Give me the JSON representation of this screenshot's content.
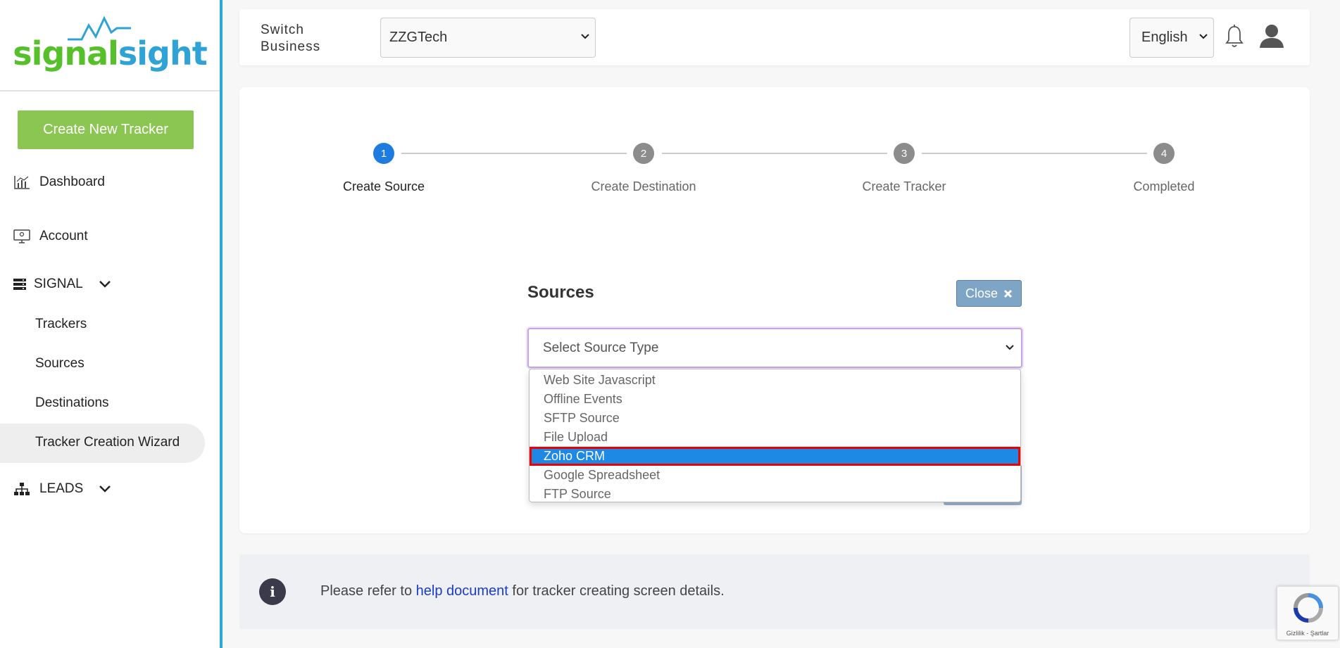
{
  "logo": {
    "part1": "signal",
    "part2": "sight"
  },
  "sidebar": {
    "create_button": "Create New Tracker",
    "items": [
      {
        "label": "Dashboard",
        "icon": "chart-icon"
      },
      {
        "label": "Account",
        "icon": "monitor-icon"
      },
      {
        "label": "SIGNAL",
        "icon": "server-icon"
      },
      {
        "label": "LEADS",
        "icon": "sitemap-icon"
      }
    ],
    "sub_items": [
      "Trackers",
      "Sources",
      "Destinations",
      "Tracker Creation Wizard"
    ]
  },
  "topbar": {
    "switch_label_line1": "Switch",
    "switch_label_line2": "Business",
    "business_value": "ZZGTech",
    "language_value": "English"
  },
  "stepper": {
    "steps": [
      {
        "num": "1",
        "label": "Create Source"
      },
      {
        "num": "2",
        "label": "Create Destination"
      },
      {
        "num": "3",
        "label": "Create Tracker"
      },
      {
        "num": "4",
        "label": "Completed"
      }
    ],
    "active_color": "#1e7be0",
    "inactive_color": "#8c8c8c"
  },
  "sources": {
    "title": "Sources",
    "close_label": "Close",
    "select_placeholder": "Select Source Type",
    "options": [
      "Web Site Javascript",
      "Offline Events",
      "SFTP Source",
      "File Upload",
      "Zoho CRM",
      "Google Spreadsheet",
      "FTP Source"
    ],
    "selected_option": "Zoho CRM"
  },
  "info": {
    "prefix": "Please refer to ",
    "link": "help document",
    "suffix": " for tracker creating screen details."
  },
  "recaptcha": {
    "text": "Gizlilik - Şartlar"
  }
}
